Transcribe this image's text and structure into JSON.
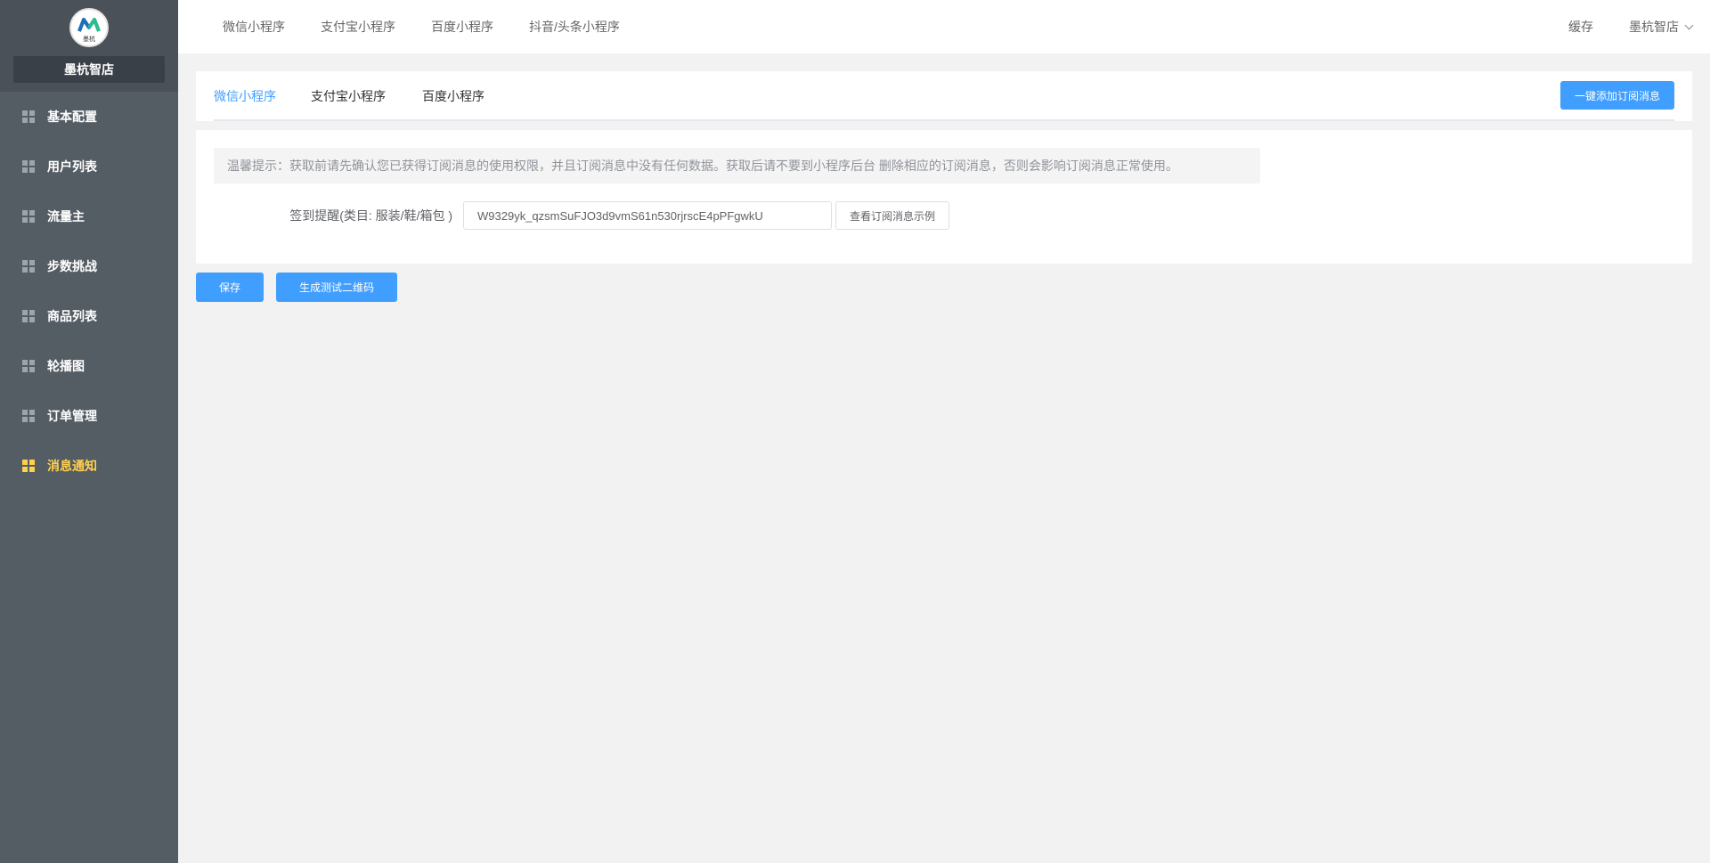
{
  "brand": {
    "logo_text": "墨杭",
    "name": "墨杭智店"
  },
  "sidebar": {
    "items": [
      {
        "label": "基本配置",
        "active": false
      },
      {
        "label": "用户列表",
        "active": false
      },
      {
        "label": "流量主",
        "active": false
      },
      {
        "label": "步数挑战",
        "active": false
      },
      {
        "label": "商品列表",
        "active": false
      },
      {
        "label": "轮播图",
        "active": false
      },
      {
        "label": "订单管理",
        "active": false
      },
      {
        "label": "消息通知",
        "active": true
      }
    ]
  },
  "topbar": {
    "tabs": [
      "微信小程序",
      "支付宝小程序",
      "百度小程序",
      "抖音/头条小程序"
    ],
    "cache_label": "缓存",
    "user_label": "墨杭智店"
  },
  "subtabs": {
    "tabs": [
      "微信小程序",
      "支付宝小程序",
      "百度小程序"
    ],
    "active_index": 0,
    "add_button": "一键添加订阅消息"
  },
  "form": {
    "tip": "温馨提示：获取前请先确认您已获得订阅消息的使用权限，并且订阅消息中没有任何数据。获取后请不要到小程序后台 删除相应的订阅消息，否则会影响订阅消息正常使用。",
    "field_label": "签到提醒(类目: 服装/鞋/箱包 )",
    "field_value": "W9329yk_qzsmSuFJO3d9vmS61n530rjrscE4pPFgwkU",
    "example_button": "查看订阅消息示例"
  },
  "actions": {
    "save": "保存",
    "qr": "生成测试二维码"
  },
  "colors": {
    "sidebar_bg": "#545c64",
    "active_menu": "#ffd04b",
    "primary": "#409eff"
  }
}
